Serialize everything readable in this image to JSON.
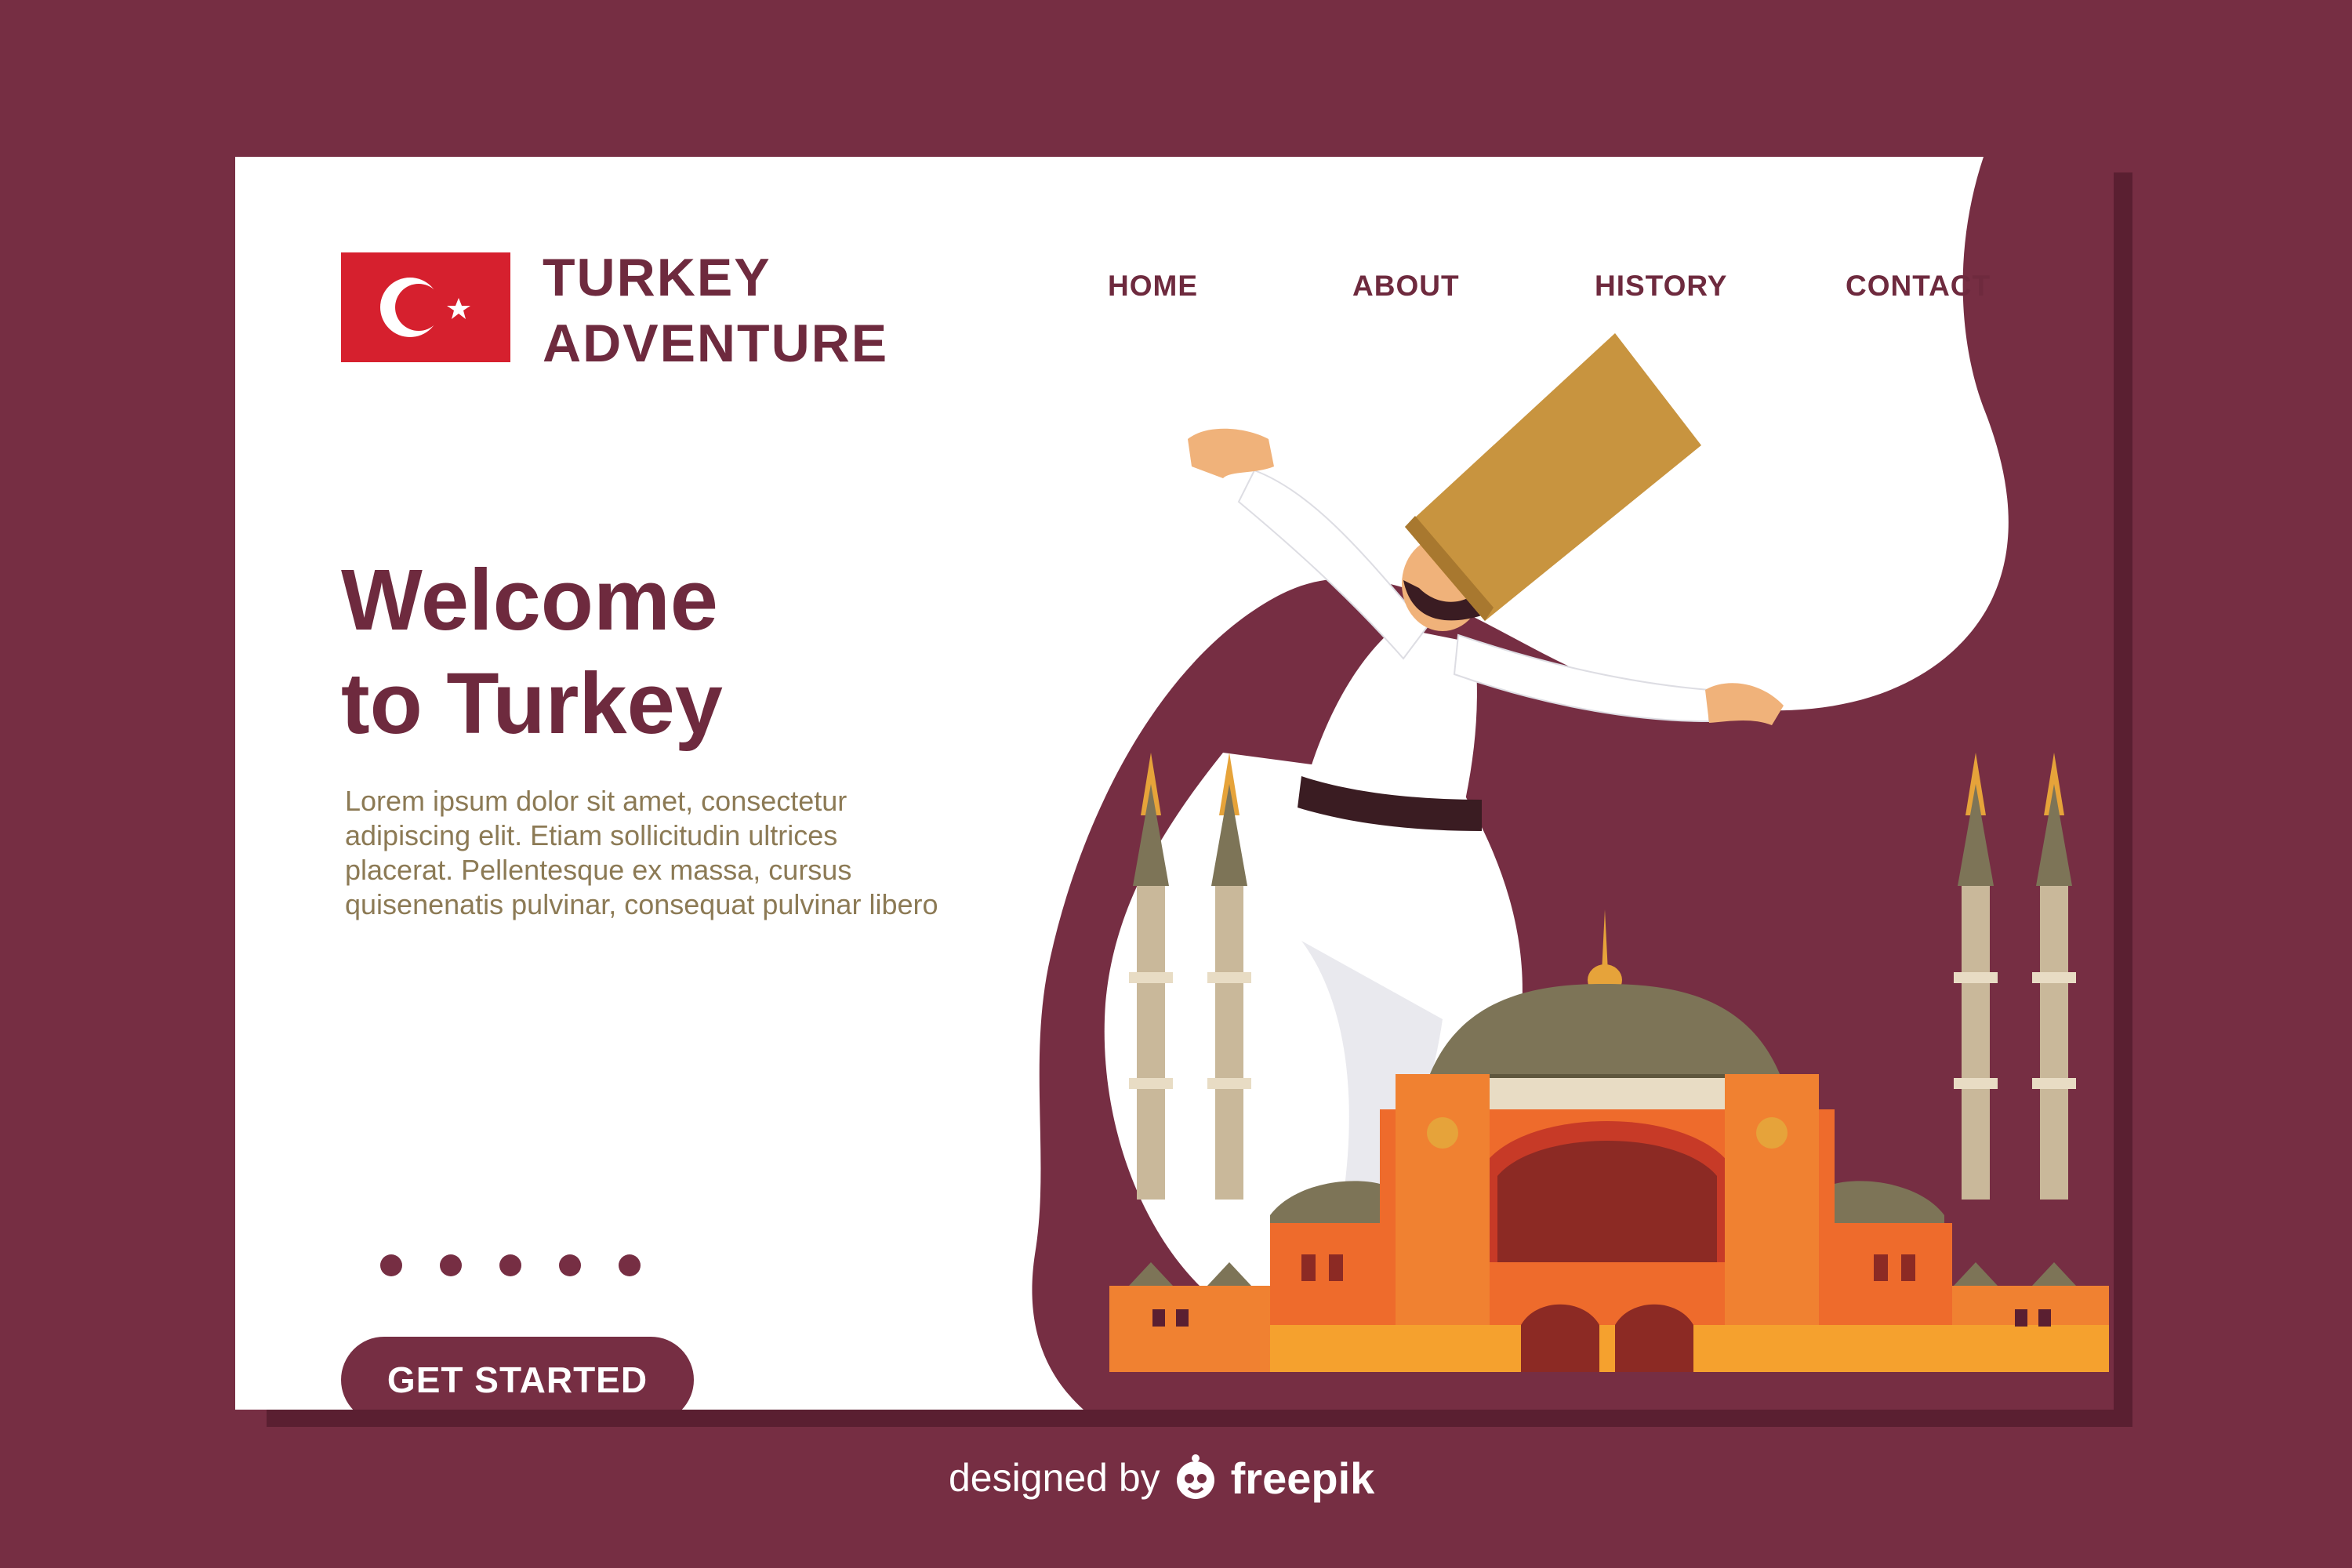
{
  "brand": {
    "line1": "TURKEY",
    "line2": "ADVENTURE"
  },
  "nav": {
    "home": "HOME",
    "about": "ABOUT",
    "history": "HISTORY",
    "contact": "CONTACT"
  },
  "hero": {
    "title_line1": "Welcome",
    "title_line2": "to Turkey",
    "body": "Lorem ipsum dolor sit amet, consectetur adipiscing elit. Etiam sollicitudin ultrices placerat. Pellentesque ex massa, cursus quisenenatis pulvinar, consequat pulvinar libero",
    "cta": "GET STARTED"
  },
  "carousel": {
    "count": 5
  },
  "credit": {
    "prefix": "designed by",
    "brand": "freepik"
  },
  "colors": {
    "background": "#762E43",
    "card": "#FFFFFF",
    "accent": "#6E2A3E",
    "body_text": "#8C7A55",
    "flag_red": "#D6202E"
  },
  "icons": [
    "turkey-flag-icon",
    "freepik-logo-icon"
  ]
}
